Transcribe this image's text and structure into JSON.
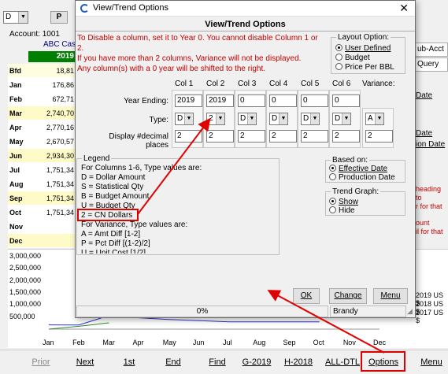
{
  "app": {
    "account_label": "Account:",
    "account_number": "1001",
    "account_name": "ABC Cash",
    "header_year": "2019",
    "rows": [
      {
        "label": "Bfd",
        "value": "18,81",
        "bg": "#fffde0"
      },
      {
        "label": "Jan",
        "value": "176,86",
        "bg": "#ffffff"
      },
      {
        "label": "Feb",
        "value": "672,71",
        "bg": "#ffffff"
      },
      {
        "label": "Mar",
        "value": "2,740,70",
        "bg": "#fffbc8"
      },
      {
        "label": "Apr",
        "value": "2,770,16",
        "bg": "#ffffff"
      },
      {
        "label": "May",
        "value": "2,670,57",
        "bg": "#ffffff"
      },
      {
        "label": "Jun",
        "value": "2,934,30",
        "bg": "#fffbc8"
      },
      {
        "label": "Jul",
        "value": "1,751,34",
        "bg": "#ffffff"
      },
      {
        "label": "Aug",
        "value": "1,751,34",
        "bg": "#ffffff"
      },
      {
        "label": "Sep",
        "value": "1,751,34",
        "bg": "#fffbc8"
      },
      {
        "label": "Oct",
        "value": "1,751,34",
        "bg": "#ffffff"
      },
      {
        "label": "Nov",
        "value": "",
        "bg": "#ffffff"
      },
      {
        "label": "Dec",
        "value": "",
        "bg": "#fffbc8"
      }
    ],
    "right_buttons": [
      "ub-Acct",
      "Query"
    ],
    "right_links": [
      "Date",
      "Date",
      "ion Date"
    ],
    "right_red_1": [
      "heading to",
      "r for that"
    ],
    "right_red_2": [
      "ount",
      "il for that"
    ],
    "legend_right": [
      "2019 US $",
      "2018 US $",
      "2017 US $"
    ],
    "top_combo": "D",
    "top_button": "P"
  },
  "chart_data": {
    "type": "line",
    "categories": [
      "Jan",
      "Feb",
      "Mar",
      "Apr",
      "May",
      "Jun",
      "Jul",
      "Aug",
      "Sep",
      "Oct",
      "Nov",
      "Dec"
    ],
    "yticks": [
      "3,000,000",
      "2,500,000",
      "2,000,000",
      "1,500,000",
      "1,000,000",
      "500,000"
    ],
    "ylim": [
      0,
      3000000
    ],
    "series": [
      {
        "name": "2019 US $",
        "color": "#3333cc",
        "values": [
          176861,
          172000,
          560000,
          470000,
          400000,
          350000,
          300000,
          300000,
          300000,
          300000
        ]
      },
      {
        "name": "2018 US $",
        "color": "#2e8b2e",
        "values": [
          0,
          120000,
          260000
        ]
      }
    ]
  },
  "dialog": {
    "title": "View/Trend Options",
    "header": "View/Trend Options",
    "note_lines": [
      "To Disable a column, set it to Year 0.  You cannot disable Column 1 or 2.",
      "If you have more than 2 columns, Variance will not be displayed.",
      "Any column(s) with a 0 year will be shifted to the right."
    ],
    "layout_option": {
      "legend": "Layout Option:",
      "options": [
        "User Defined",
        "Budget",
        "Price Per BBL"
      ],
      "selected": 0
    },
    "columns": {
      "headers": [
        "Col 1",
        "Col 2",
        "Col 3",
        "Col 4",
        "Col 5",
        "Col 6",
        "Variance:"
      ],
      "year_label": "Year Ending:",
      "years": [
        "2019",
        "2019",
        "0",
        "0",
        "0",
        "0"
      ],
      "type_label": "Type:",
      "types": [
        "D",
        "2",
        "D",
        "D",
        "D",
        "D",
        "A"
      ],
      "decimal_label": "Display #decimal places",
      "decimals": [
        "2",
        "2",
        "2",
        "2",
        "2",
        "2",
        "2"
      ]
    },
    "legend_box": {
      "legend": "Legend",
      "lines": [
        "For Columns 1-6, Type values are:",
        "D = Dollar Amount",
        "S = Statistical Qty",
        "B = Budget Amount",
        "U = Budget Qty",
        "2 = CN Dollars",
        "For Variance, Type values are:",
        "A = Amt Diff [1-2]",
        "P = Pct Diff [(1-2)/2]",
        "U = Unit Cost [1/2]"
      ]
    },
    "based_on": {
      "legend": "Based on:",
      "options": [
        "Effective Date",
        "Production Date"
      ],
      "selected": 0
    },
    "trend_graph": {
      "legend": "Trend Graph:",
      "options": [
        "Show",
        "Hide"
      ],
      "selected": 0
    },
    "buttons": {
      "ok": "OK",
      "change": "Change",
      "menu": "Menu"
    },
    "status": {
      "progress": "0%",
      "user": "Brandy"
    }
  },
  "bottom_bar": [
    {
      "label": "Prior",
      "dim": true
    },
    {
      "label": "Next",
      "dim": false
    },
    {
      "label": "1st",
      "dim": false
    },
    {
      "label": "End",
      "dim": false
    },
    {
      "label": "Find",
      "dim": false
    },
    {
      "label": "G-2019",
      "dim": false
    },
    {
      "label": "H-2018",
      "dim": false
    },
    {
      "label": "ALL-DTL",
      "dim": false
    },
    {
      "label": "Options",
      "dim": false
    },
    {
      "label": "Menu",
      "dim": false
    }
  ],
  "annotation_color": "#e00000"
}
